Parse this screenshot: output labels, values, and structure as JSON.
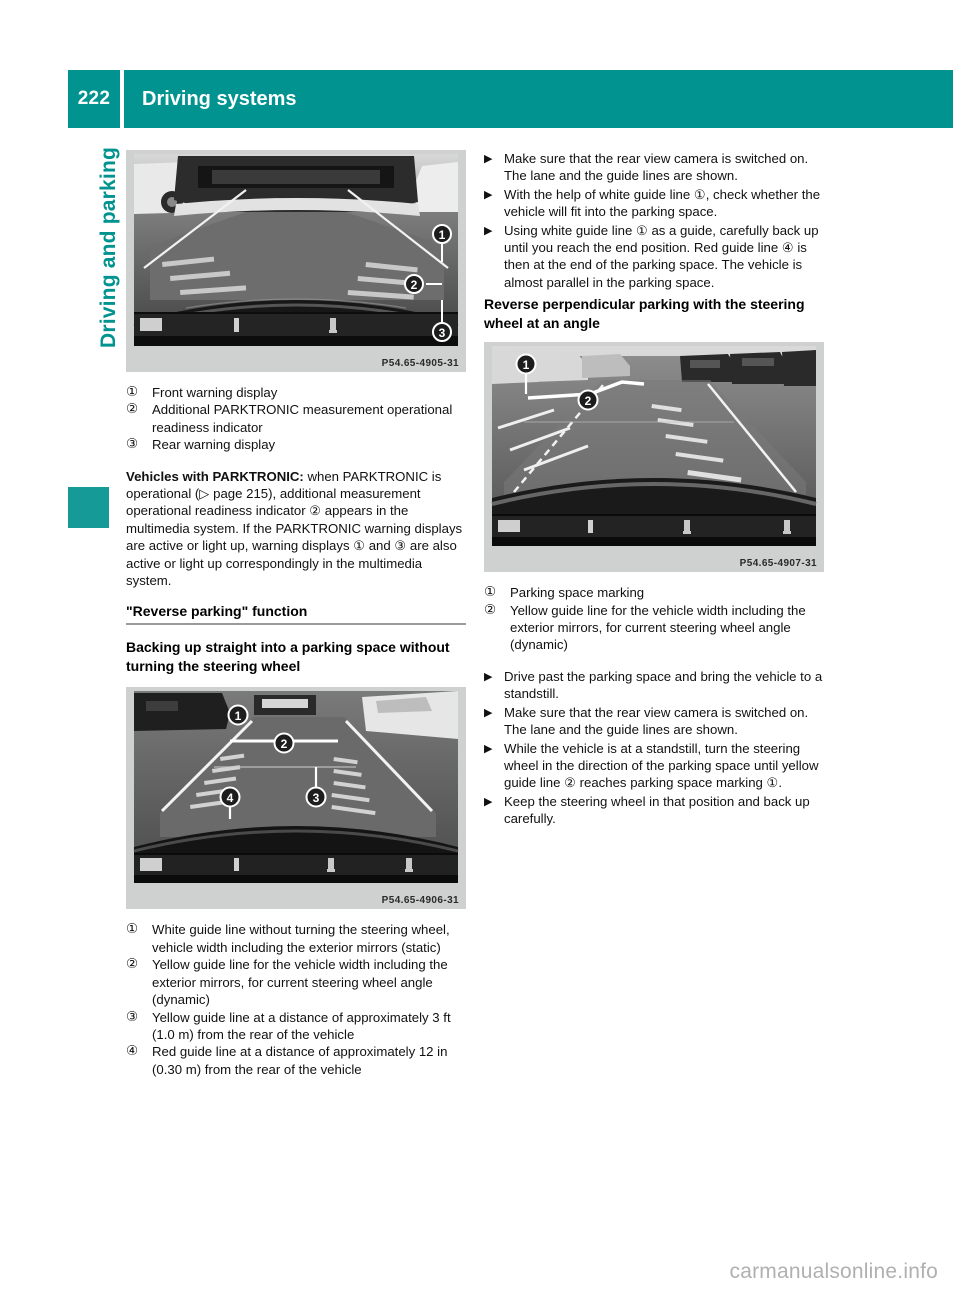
{
  "header": {
    "page_number": "222",
    "title": "Driving systems"
  },
  "sidebar": {
    "chapter_label": "Driving and parking",
    "accent_color": "#00938f"
  },
  "figures": {
    "parktronic_display": {
      "id_code": "P54.65-4905-31",
      "alt": "Rear view camera image showing PARKTRONIC warning displays with callouts 1, 2, 3"
    },
    "straight_parking": {
      "id_code": "P54.65-4906-31",
      "alt": "Rear view camera image with guide lines and callouts 1, 2, 3, 4"
    },
    "perpendicular_parking": {
      "id_code": "P54.65-4907-31",
      "alt": "Rear view camera image of perpendicular parking with callouts 1, 2"
    }
  },
  "left_column": {
    "legend_1": [
      {
        "marker": "①",
        "text": "Front warning display"
      },
      {
        "marker": "②",
        "text": "Additional PARKTRONIC measurement operational readiness indicator"
      },
      {
        "marker": "③",
        "text": "Rear warning display"
      }
    ],
    "parktronic_paragraph": {
      "lead": "Vehicles with PARKTRONIC:",
      "body": " when PARKTRONIC is operational (▷ page 215), additional measurement operational readiness indicator ② appears in the multimedia system. If the PARKTRONIC warning displays are active or light up, warning displays ① and ③ are also active or light up correspondingly in the multimedia system."
    },
    "section_heading": "\"Reverse parking\" function",
    "subsection_heading": "Backing up straight into a parking space without turning the steering wheel",
    "legend_2": [
      {
        "marker": "①",
        "text": "White guide line without turning the steering wheel, vehicle width including the exterior mirrors (static)"
      },
      {
        "marker": "②",
        "text": "Yellow guide line for the vehicle width including the exterior mirrors, for current steering wheel angle (dynamic)"
      },
      {
        "marker": "③",
        "text": "Yellow guide line at a distance of approximately 3 ft (1.0 m) from the rear of the vehicle"
      },
      {
        "marker": "④",
        "text": "Red guide line at a distance of approximately 12 in (0.30 m) from the rear of the vehicle"
      }
    ]
  },
  "right_column": {
    "top_bullets": [
      {
        "marker": "▶",
        "text": "Make sure that the rear view camera is switched on.\nThe lane and the guide lines are shown."
      },
      {
        "marker": "▶",
        "text": "With the help of white guide line ①, check whether the vehicle will fit into the parking space."
      },
      {
        "marker": "▶",
        "text": "Using white guide line ① as a guide, carefully back up until you reach the end position. Red guide line ④ is then at the end of the parking space. The vehicle is almost parallel in the parking space."
      }
    ],
    "section_heading": "Reverse perpendicular parking with the steering wheel at an angle",
    "legend_3": [
      {
        "marker": "①",
        "text": "Parking space marking"
      },
      {
        "marker": "②",
        "text": "Yellow guide line for the vehicle width including the exterior mirrors, for current steering wheel angle (dynamic)"
      }
    ],
    "bottom_bullets": [
      {
        "marker": "▶",
        "text": "Drive past the parking space and bring the vehicle to a standstill."
      },
      {
        "marker": "▶",
        "text": "Make sure that the rear view camera is switched on.\nThe lane and the guide lines are shown."
      },
      {
        "marker": "▶",
        "text": "While the vehicle is at a standstill, turn the steering wheel in the direction of the parking space until yellow guide line ② reaches parking space marking ①."
      },
      {
        "marker": "▶",
        "text": "Keep the steering wheel in that position and back up carefully."
      }
    ]
  },
  "watermark": "carmanualsonline.info"
}
